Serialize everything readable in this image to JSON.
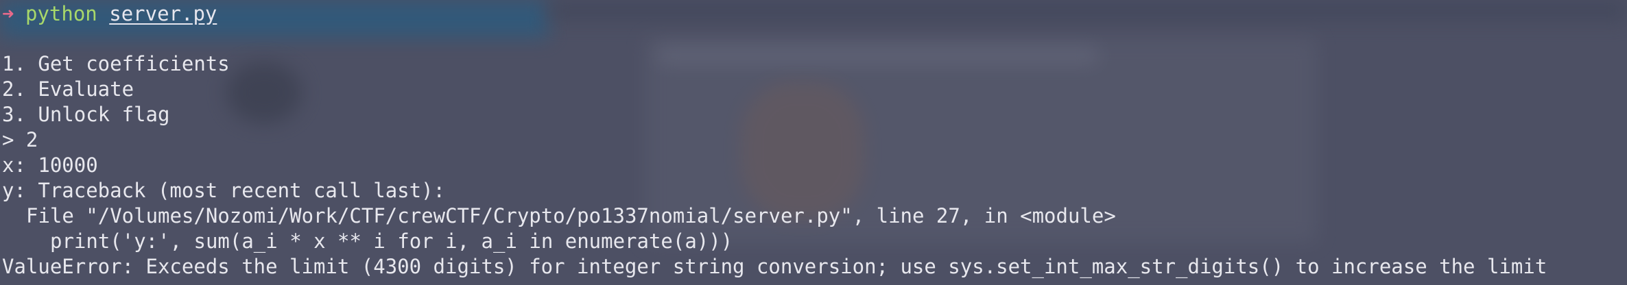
{
  "terminal": {
    "prompt_symbol": "➜",
    "command": "python",
    "command_arg": "server.py",
    "menu": [
      "1. Get coefficients",
      "2. Evaluate",
      "3. Unlock flag"
    ],
    "input_prompt": "> 2",
    "x_line": "x: 10000",
    "traceback_header": "y: Traceback (most recent call last):",
    "traceback_file": "File \"/Volumes/Nozomi/Work/CTF/crewCTF/Crypto/po1337nomial/server.py\", line 27, in <module>",
    "traceback_code": "print('y:', sum(a_i * x ** i for i, a_i in enumerate(a)))",
    "error": "ValueError: Exceeds the limit (4300 digits) for integer string conversion; use sys.set_int_max_str_digits() to increase the limit"
  },
  "colors": {
    "background": "#4d5064",
    "text": "#e8e8ee",
    "prompt_arrow": "#e86a8a",
    "command": "#a8d86a"
  }
}
